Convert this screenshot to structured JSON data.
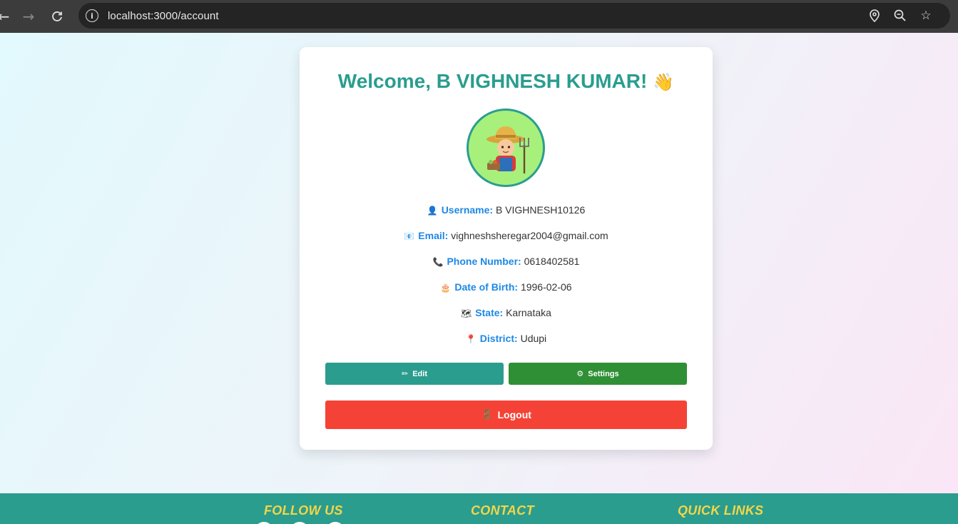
{
  "browser": {
    "url": "localhost:3000/account"
  },
  "card": {
    "welcome": "Welcome, B VIGHNESH KUMAR!",
    "wave_emoji": "👋",
    "fields": [
      {
        "icon": "👤",
        "label": "Username:",
        "value": "B VIGHNESH10126"
      },
      {
        "icon": "📧",
        "label": "Email:",
        "value": "vighneshsheregar2004@gmail.com"
      },
      {
        "icon": "📞",
        "label": "Phone Number:",
        "value": "0618402581"
      },
      {
        "icon": "🎂",
        "label": "Date of Birth:",
        "value": "1996-02-06"
      },
      {
        "icon": "🗺",
        "label": "State:",
        "value": "Karnataka"
      },
      {
        "icon": "📍",
        "label": "District:",
        "value": "Udupi"
      }
    ],
    "buttons": {
      "edit_icon": "✏",
      "edit": "Edit",
      "settings_icon": "⚙",
      "settings": "Settings",
      "logout_icon": "🚪",
      "logout": "Logout"
    }
  },
  "footer": {
    "follow": "FOLLOW US",
    "contact": "CONTACT",
    "links": "QUICK LINKS"
  },
  "colors": {
    "accent": "#2a9d8f",
    "settings": "#2f8f35",
    "logout": "#f44336",
    "label": "#1e88e5",
    "footer_heading": "#f5d547"
  }
}
